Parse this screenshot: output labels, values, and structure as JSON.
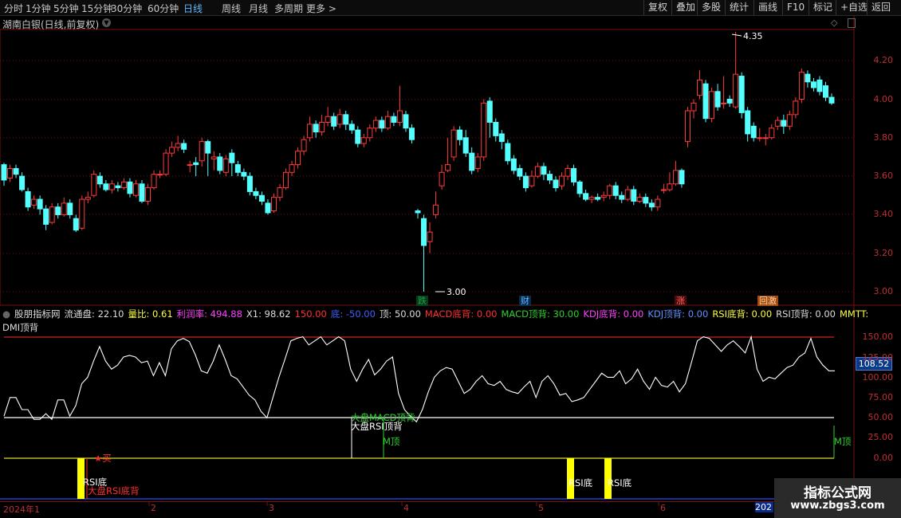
{
  "toolbar": {
    "periods": [
      "分时",
      "1分钟",
      "5分钟",
      "15分钟",
      "30分钟",
      "60分钟",
      "日线",
      "周线",
      "月线",
      "多周期",
      "更多 >"
    ],
    "active_period": "日线",
    "right_buttons": [
      "复权",
      "叠加",
      "多股",
      "统计",
      "画线",
      "F10",
      "标记",
      "+自选",
      "返回"
    ]
  },
  "title": "湖南白银(日线,前复权)",
  "price_axis": [
    "4.20",
    "4.00",
    "3.80",
    "3.60",
    "3.40",
    "3.20",
    "3.00"
  ],
  "max_label": "4.35",
  "min_label": "3.00",
  "event_tags": [
    {
      "text": "跌",
      "color": "#1aa04a",
      "bg": "#0a3a1a"
    },
    {
      "text": "财",
      "color": "#5fb8ff",
      "bg": "#0a2a4a"
    },
    {
      "text": "涨",
      "color": "#ff6060",
      "bg": "#4a0a0a"
    },
    {
      "text": "回激",
      "color": "#ffd0a0",
      "bg": "#a04a10"
    }
  ],
  "indicator": {
    "name": "股朋指标网",
    "fields": [
      {
        "label": "流通盘: 22.10",
        "color": "#dddddd"
      },
      {
        "label": "量比: 0.61",
        "color": "#ffff40"
      },
      {
        "label": "利润率: 494.88",
        "color": "#ff40ff"
      },
      {
        "label": "X1: 98.62",
        "color": "#dddddd"
      },
      {
        "label": "150.00",
        "color": "#ff3030"
      },
      {
        "label": "底: -50.00",
        "color": "#4060ff"
      },
      {
        "label": "顶: 50.00",
        "color": "#dddddd"
      },
      {
        "label": "MACD底背: 0.00",
        "color": "#ff3030"
      },
      {
        "label": "MACD顶背: 30.00",
        "color": "#30d030"
      },
      {
        "label": "KDJ底背: 0.00",
        "color": "#ff40ff"
      },
      {
        "label": "KDJ顶背: 0.00",
        "color": "#6090ff"
      },
      {
        "label": "RSI底背: 0.00",
        "color": "#ffff40"
      },
      {
        "label": "RSI顶背: 0.00",
        "color": "#dddddd"
      },
      {
        "label": "MMTT:",
        "color": "#ffff40"
      }
    ],
    "line2": "DMI顶背",
    "axis": [
      "150.00",
      "125.00",
      "100.00",
      "75.00",
      "50.00",
      "25.00",
      "0.00"
    ],
    "current_value": "108.52"
  },
  "annotations": {
    "buy": "★买",
    "rsi_bottom": "RSI底",
    "big_rsi_bottom": "大盘RSI底背",
    "big_macd_top": "大盘MACD顶背",
    "big_rsi_top": "大盘RSI顶背",
    "m_top": "M顶"
  },
  "dates": [
    "2024年1",
    "2",
    "3",
    "4",
    "5",
    "6",
    "202"
  ],
  "logo": {
    "main": "指标公式网",
    "url": "www.zbgs3.com"
  },
  "colors": {
    "up": "#ff3b3b",
    "down": "#54ffff",
    "grid": "#7a1010"
  }
}
